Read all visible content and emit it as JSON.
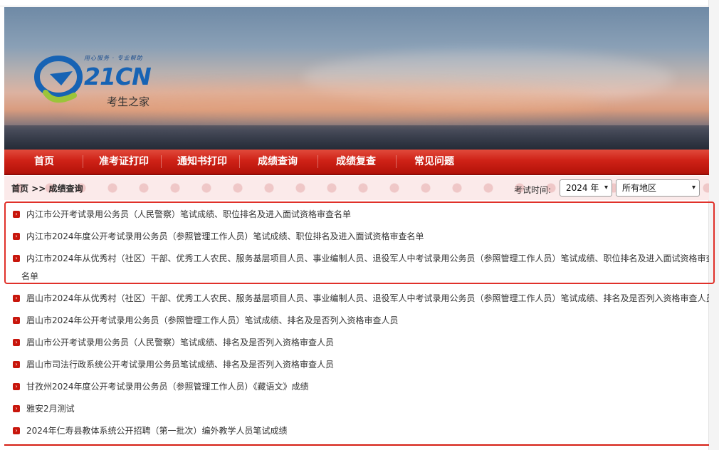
{
  "logo": {
    "slogan": "用心服务 · 专业帮助",
    "brand": "21CN",
    "subtitle": "考生之家"
  },
  "nav": {
    "items": [
      {
        "label": "首页"
      },
      {
        "label": "准考证打印"
      },
      {
        "label": "通知书打印"
      },
      {
        "label": "成绩查询"
      },
      {
        "label": "成绩复查"
      },
      {
        "label": "常见问题"
      }
    ]
  },
  "breadcrumb": {
    "home": "首页",
    "sep": ">>",
    "current": "成绩查询"
  },
  "filters": {
    "exam_time_label": "考试时间:",
    "year_selected": "2024 年",
    "region_selected": "所有地区"
  },
  "list": {
    "items": [
      {
        "text": "内江市公开考试录用公务员（人民警察）笔试成绩、职位排名及进入面试资格审查名单"
      },
      {
        "text": "内江市2024年度公开考试录用公务员（参照管理工作人员）笔试成绩、职位排名及进入面试资格审查名单"
      },
      {
        "text": "内江市2024年从优秀村（社区）干部、优秀工人农民、服务基层项目人员、事业编制人员、退役军人中考试录用公务员（参照管理工作人员）笔试成绩、职位排名及进入面试资格审查",
        "text_line2": "名单"
      },
      {
        "text": "眉山市2024年从优秀村（社区）干部、优秀工人农民、服务基层项目人员、事业编制人员、退役军人中考试录用公务员（参照管理工作人员）笔试成绩、排名及是否列入资格审查人员"
      },
      {
        "text": "眉山市2024年公开考试录用公务员（参照管理工作人员）笔试成绩、排名及是否列入资格审查人员"
      },
      {
        "text": "眉山市公开考试录用公务员（人民警察）笔试成绩、排名及是否列入资格审查人员"
      },
      {
        "text": "眉山市司法行政系统公开考试录用公务员笔试成绩、排名及是否列入资格审查人员"
      },
      {
        "text": "甘孜州2024年度公开考试录用公务员（参照管理工作人员）《藏语文》成绩"
      },
      {
        "text": "雅安2月测试"
      },
      {
        "text": "2024年仁寿县教体系统公开招聘（第一批次）编外教学人员笔试成绩"
      }
    ]
  },
  "colors": {
    "accent": "#c8160c",
    "nav_red": "#cf2217",
    "highlight": "#e0312a"
  }
}
